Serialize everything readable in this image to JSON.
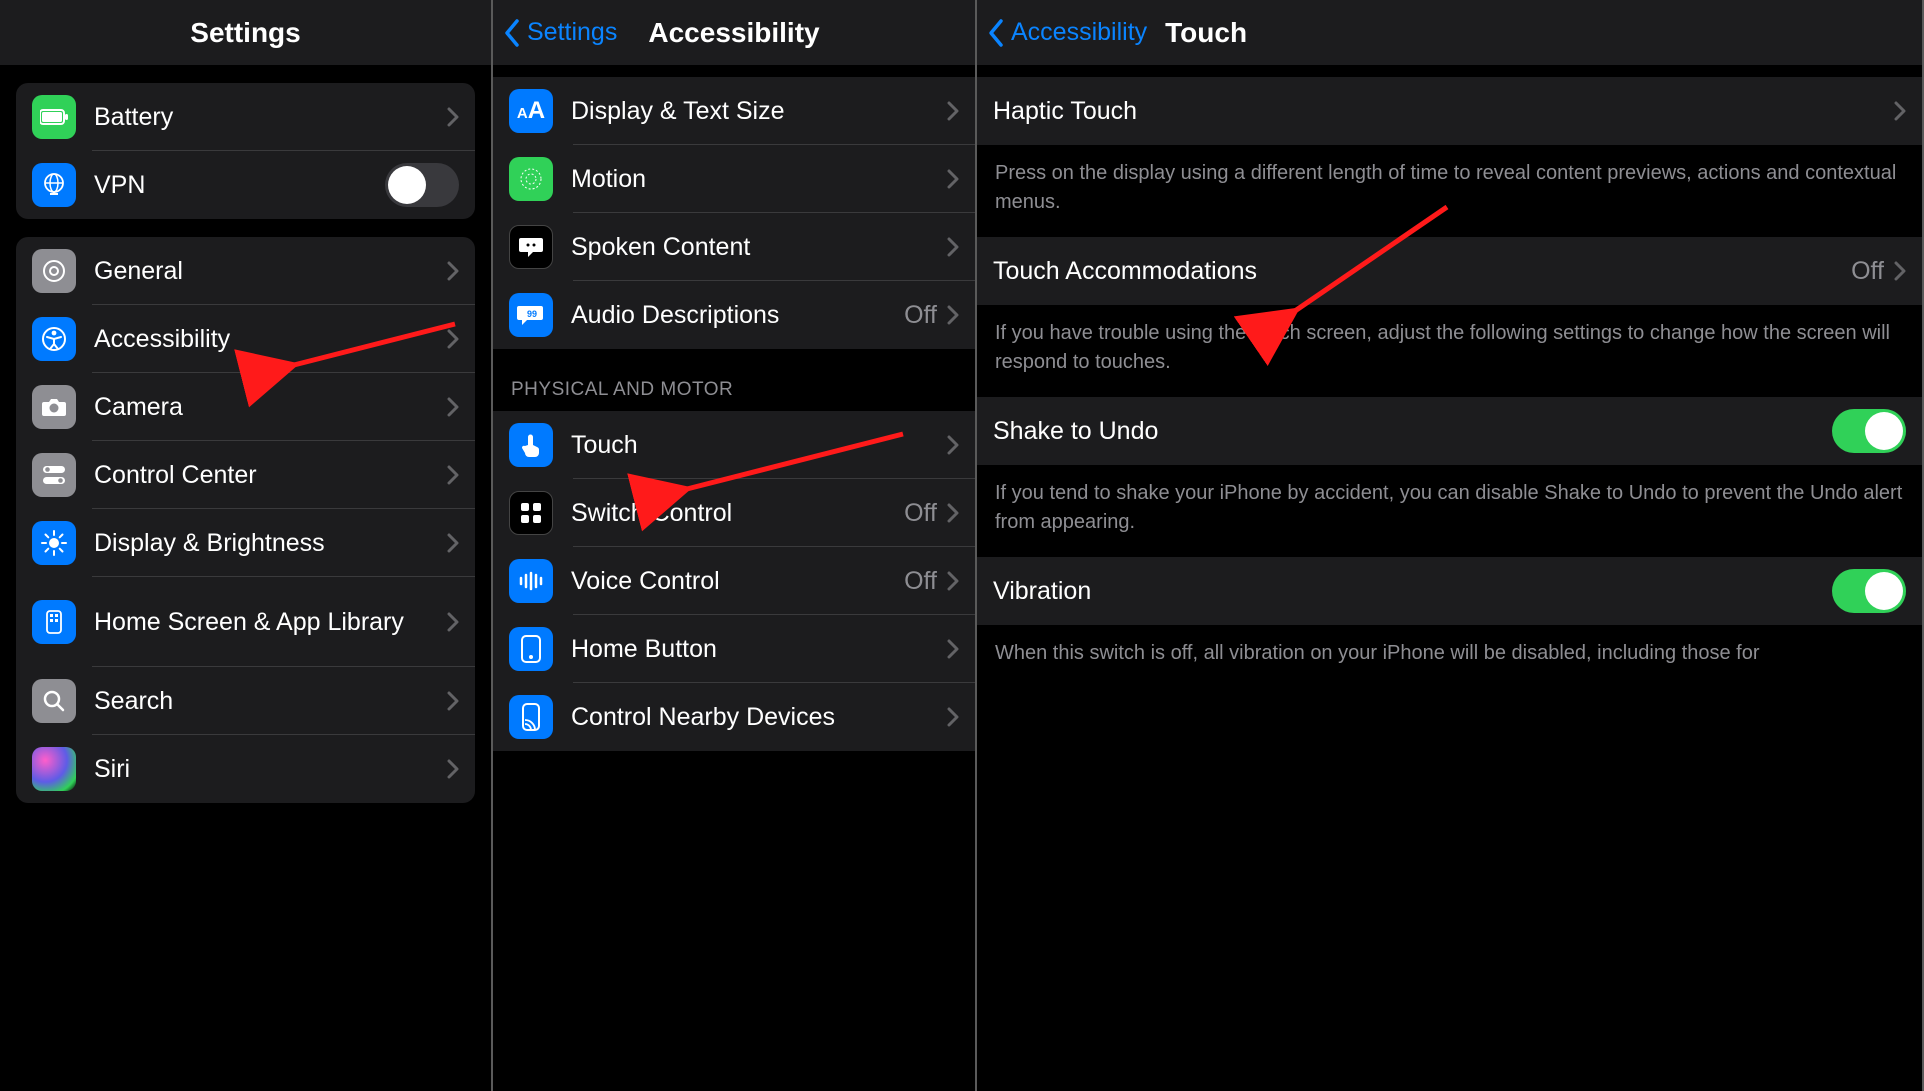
{
  "panel1": {
    "title": "Settings",
    "group_top": [
      {
        "id": "battery",
        "label": "Battery",
        "icon": "battery-icon",
        "bg": "bg-green",
        "chevron": true
      },
      {
        "id": "vpn",
        "label": "VPN",
        "icon": "globe-icon",
        "bg": "bg-blue",
        "toggle": false
      }
    ],
    "group_bottom": [
      {
        "id": "general",
        "label": "General",
        "icon": "gear-icon",
        "bg": "bg-grey"
      },
      {
        "id": "accessibility",
        "label": "Accessibility",
        "icon": "accessibility-icon",
        "bg": "bg-blue"
      },
      {
        "id": "camera",
        "label": "Camera",
        "icon": "camera-icon",
        "bg": "bg-grey"
      },
      {
        "id": "controlcenter",
        "label": "Control Center",
        "icon": "switches-icon",
        "bg": "bg-grey"
      },
      {
        "id": "display",
        "label": "Display & Brightness",
        "icon": "brightness-icon",
        "bg": "bg-blue"
      },
      {
        "id": "homescreen",
        "label": "Home Screen & App Library",
        "icon": "apps-icon",
        "bg": "bg-blue"
      },
      {
        "id": "search",
        "label": "Search",
        "icon": "search-icon",
        "bg": "bg-grey"
      },
      {
        "id": "siri",
        "label": "Siri",
        "icon": "siri-icon",
        "bg": "siri-icon"
      }
    ]
  },
  "panel2": {
    "back": "Settings",
    "title": "Accessibility",
    "group_vision": [
      {
        "id": "displaytext",
        "label": "Display & Text Size",
        "icon": "textsize-icon",
        "bg": "bg-blue"
      },
      {
        "id": "motion",
        "label": "Motion",
        "icon": "motion-icon",
        "bg": "bg-green"
      },
      {
        "id": "spoken",
        "label": "Spoken Content",
        "icon": "speech-icon",
        "bg": "bg-black"
      },
      {
        "id": "audiodesc",
        "label": "Audio Descriptions",
        "icon": "audiodesc-icon",
        "bg": "bg-blue",
        "value": "Off"
      }
    ],
    "section_header": "Physical and Motor",
    "group_motor": [
      {
        "id": "touch",
        "label": "Touch",
        "icon": "touch-icon",
        "bg": "bg-blue"
      },
      {
        "id": "switch",
        "label": "Switch Control",
        "icon": "switch-icon",
        "bg": "bg-black",
        "value": "Off"
      },
      {
        "id": "voice",
        "label": "Voice Control",
        "icon": "voice-icon",
        "bg": "bg-blue",
        "value": "Off"
      },
      {
        "id": "homebutton",
        "label": "Home Button",
        "icon": "home-icon",
        "bg": "bg-blue"
      },
      {
        "id": "nearby",
        "label": "Control Nearby Devices",
        "icon": "nearby-icon",
        "bg": "bg-blue"
      }
    ]
  },
  "panel3": {
    "back": "Accessibility",
    "title": "Touch",
    "haptic": {
      "label": "Haptic Touch"
    },
    "haptic_note": "Press on the display using a different length of time to reveal content previews, actions and contextual menus.",
    "touch_acc": {
      "label": "Touch Accommodations",
      "value": "Off"
    },
    "touch_acc_note": "If you have trouble using the touch screen, adjust the following settings to change how the screen will respond to touches.",
    "shake": {
      "label": "Shake to Undo",
      "toggle": true
    },
    "shake_note": "If you tend to shake your iPhone by accident, you can disable Shake to Undo to prevent the Undo alert from appearing.",
    "vibration": {
      "label": "Vibration",
      "toggle": true
    },
    "vibration_note": "When this switch is off, all vibration on your iPhone will be disabled, including those for"
  }
}
